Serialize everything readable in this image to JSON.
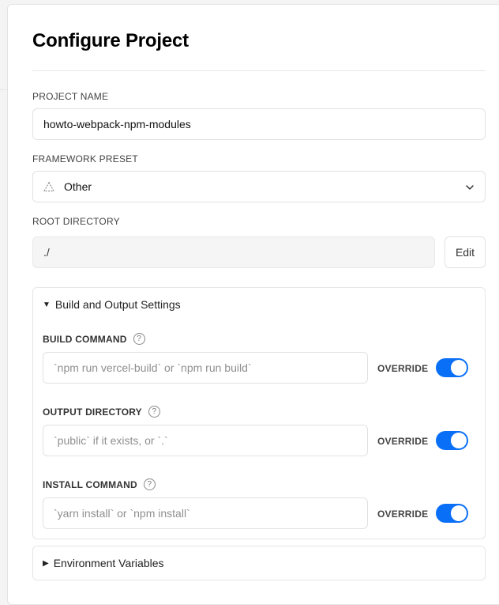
{
  "page": {
    "title": "Configure Project"
  },
  "project_name": {
    "label": "PROJECT NAME",
    "value": "howto-webpack-npm-modules"
  },
  "framework": {
    "label": "FRAMEWORK PRESET",
    "value": "Other",
    "icon": "triangle-outline-icon"
  },
  "root_directory": {
    "label": "ROOT DIRECTORY",
    "value": "./",
    "edit_label": "Edit"
  },
  "build_settings": {
    "header": "Build and Output Settings",
    "expanded": true,
    "override_label": "OVERRIDE",
    "accent": "#0a6ff7",
    "items": [
      {
        "label": "BUILD COMMAND",
        "placeholder": "`npm run vercel-build` or `npm run build`",
        "override": true
      },
      {
        "label": "OUTPUT DIRECTORY",
        "placeholder": "`public` if it exists, or `.`",
        "override": true
      },
      {
        "label": "INSTALL COMMAND",
        "placeholder": "`yarn install` or `npm install`",
        "override": true
      }
    ]
  },
  "env_vars": {
    "header": "Environment Variables",
    "expanded": false
  }
}
